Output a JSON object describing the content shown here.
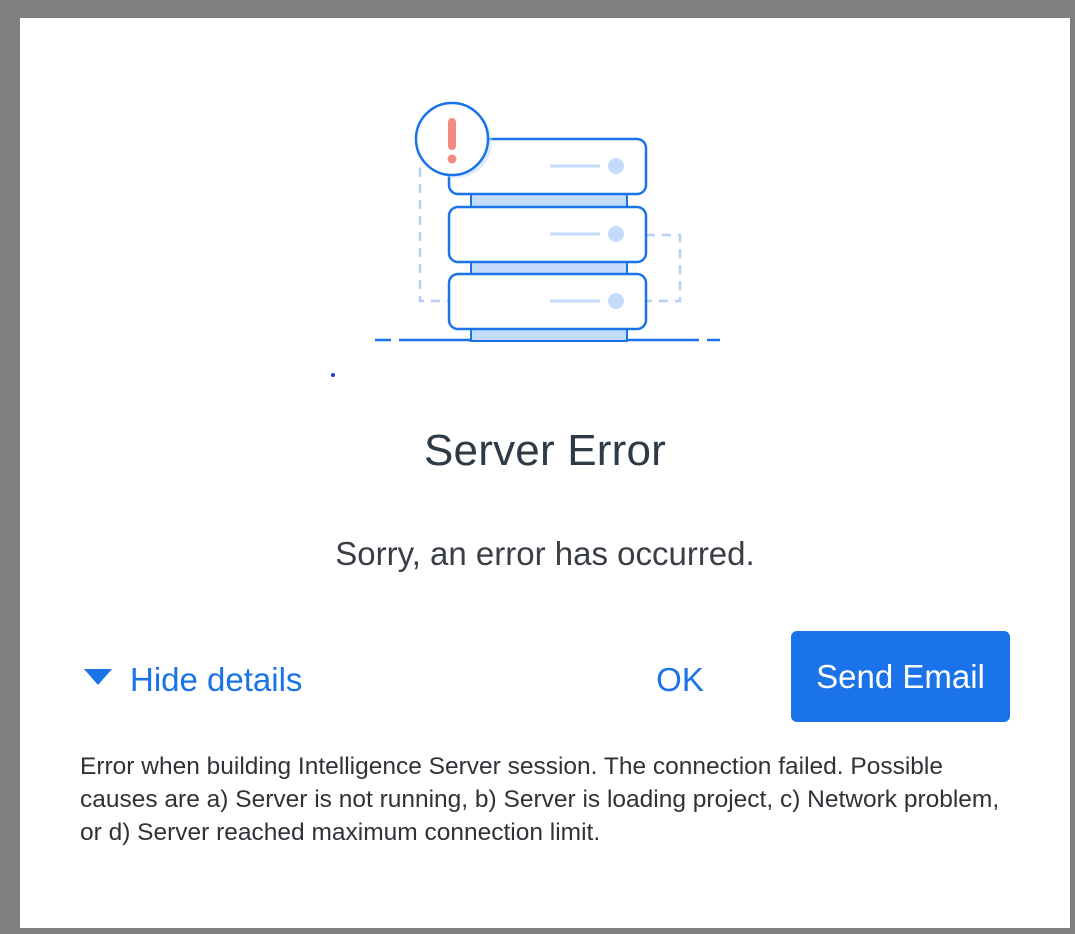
{
  "dialog": {
    "illustration_icon": "server-error-icon",
    "alert_icon": "exclamation-icon",
    "title": "Server Error",
    "message": "Sorry, an error has occurred.",
    "details_toggle": {
      "label": "Hide details",
      "icon": "caret-down-icon"
    },
    "ok_label": "OK",
    "send_email_label": "Send Email",
    "details_text": "Error when building Intelligence Server session. The connection failed. Possible causes are a) Server is not running, b) Server is loading project, c) Network problem, or d) Server reached maximum connection limit."
  },
  "colors": {
    "accent": "#1a73e8",
    "alert": "#f28b82",
    "illustration_fill": "#c5dbfb"
  }
}
